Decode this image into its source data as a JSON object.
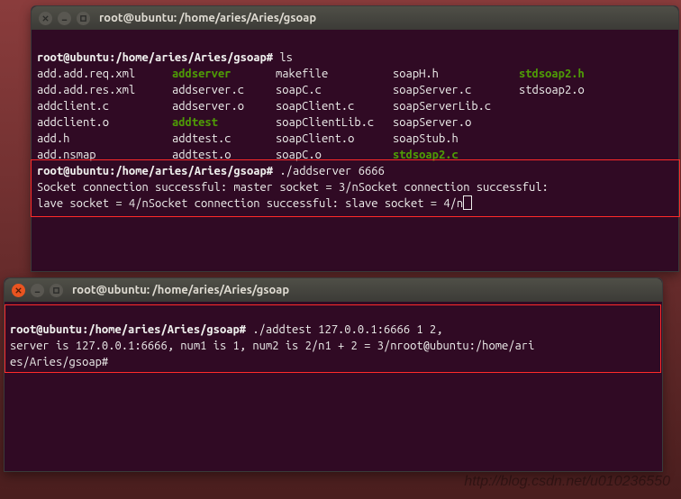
{
  "window1": {
    "title": "root@ubuntu: /home/aries/Aries/gsoap",
    "prompt": "root@ubuntu:/home/aries/Aries/gsoap#",
    "cmd_ls": "ls",
    "ls": [
      [
        {
          "t": "add.add.req.xml",
          "c": ""
        },
        {
          "t": "addserver",
          "c": "green"
        },
        {
          "t": "makefile",
          "c": ""
        },
        {
          "t": "soapH.h",
          "c": ""
        },
        {
          "t": "stdsoap2.h",
          "c": "green"
        }
      ],
      [
        {
          "t": "add.add.res.xml",
          "c": ""
        },
        {
          "t": "addserver.c",
          "c": ""
        },
        {
          "t": "soapC.c",
          "c": ""
        },
        {
          "t": "soapServer.c",
          "c": ""
        },
        {
          "t": "stdsoap2.o",
          "c": ""
        }
      ],
      [
        {
          "t": "addclient.c",
          "c": ""
        },
        {
          "t": "addserver.o",
          "c": ""
        },
        {
          "t": "soapClient.c",
          "c": ""
        },
        {
          "t": "soapServerLib.c",
          "c": ""
        },
        {
          "t": "",
          "c": ""
        }
      ],
      [
        {
          "t": "addclient.o",
          "c": ""
        },
        {
          "t": "addtest",
          "c": "green"
        },
        {
          "t": "soapClientLib.c",
          "c": ""
        },
        {
          "t": "soapServer.o",
          "c": ""
        },
        {
          "t": "",
          "c": ""
        }
      ],
      [
        {
          "t": "add.h",
          "c": ""
        },
        {
          "t": "addtest.c",
          "c": ""
        },
        {
          "t": "soapClient.o",
          "c": ""
        },
        {
          "t": "soapStub.h",
          "c": ""
        },
        {
          "t": "",
          "c": ""
        }
      ],
      [
        {
          "t": "add.nsmap",
          "c": ""
        },
        {
          "t": "addtest.o",
          "c": ""
        },
        {
          "t": "soapC.o",
          "c": ""
        },
        {
          "t": "stdsoap2.c",
          "c": "green"
        },
        {
          "t": "",
          "c": ""
        }
      ]
    ],
    "cmd_run": "./addserver 6666",
    "out1": "Socket connection successful: master socket = 3/nSocket connection successful:",
    "out2_a": "lave socket = 4/nSocket connection successful: slave socket = 4/n"
  },
  "window2": {
    "title": "root@ubuntu: /home/aries/Aries/gsoap",
    "prompt": "root@ubuntu:/home/aries/Aries/gsoap#",
    "cmd_run": "./addtest 127.0.0.1:6666 1 2,",
    "out1": "server is 127.0.0.1:6666, num1 is 1, num2 is 2/n1 + 2 = 3/nroot@ubuntu:/home/ari",
    "out2": "es/Aries/gsoap# "
  },
  "watermark": "http://blog.csdn.net/u010236550"
}
